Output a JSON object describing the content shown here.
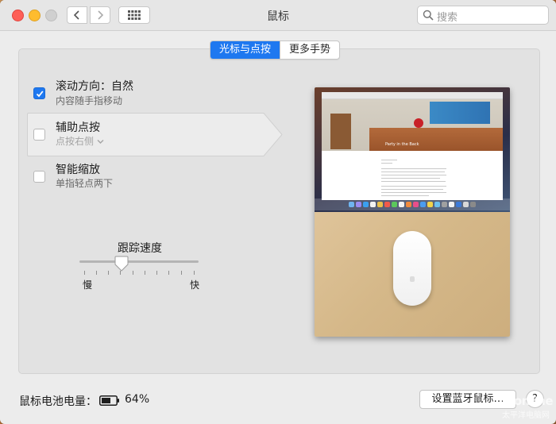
{
  "window": {
    "title": "鼠标",
    "search_placeholder": "搜索"
  },
  "tabs": [
    {
      "label": "光标与点按",
      "active": true
    },
    {
      "label": "更多手势",
      "active": false
    }
  ],
  "options": [
    {
      "title": "滚动方向：自然",
      "subtitle": "内容随手指移动",
      "checked": true
    },
    {
      "title": "辅助点按",
      "subtitle": "点按右侧",
      "checked": false
    },
    {
      "title": "智能缩放",
      "subtitle": "单指轻点两下",
      "checked": false
    }
  ],
  "tracking": {
    "label": "跟踪速度",
    "min_label": "慢",
    "max_label": "快",
    "value_fraction": 0.35
  },
  "preview": {
    "page_title": "Party in the Back"
  },
  "battery": {
    "label": "鼠标电池电量：",
    "percent": "64%"
  },
  "bluetooth_button": "设置蓝牙鼠标…",
  "help_button": "?",
  "watermark": {
    "brand": "pconline",
    "sub": "太平洋电脑网"
  },
  "colors": {
    "accent": "#1e78f0",
    "close": "#fe5f57",
    "minimize": "#febc2e"
  }
}
